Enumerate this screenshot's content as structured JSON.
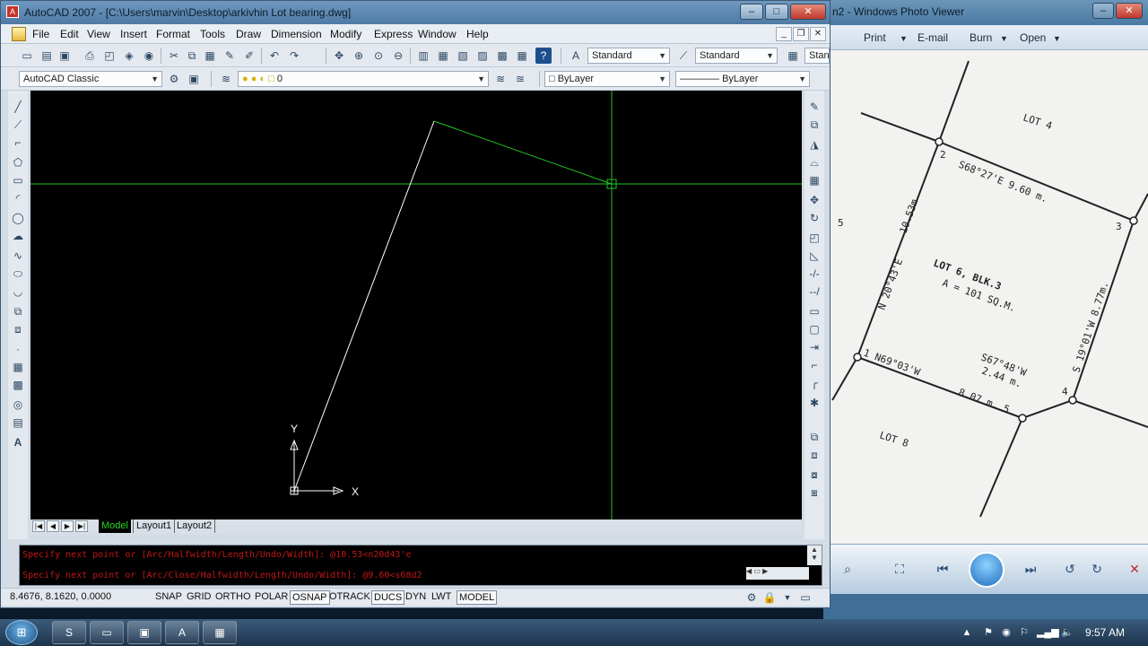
{
  "photo_viewer": {
    "title": "n2 - Windows Photo Viewer",
    "menu": [
      {
        "label": "Print"
      },
      {
        "label": "E-mail"
      },
      {
        "label": "Burn"
      },
      {
        "label": "Open"
      }
    ],
    "plan": {
      "lot4": "LOT 4",
      "lot8": "LOT 8",
      "title": "LOT 6, BLK.3",
      "area": "A = 101 SQ.M.",
      "b1": "S68°27'E   9.60 m.",
      "b2": "10.53m",
      "b3": "N 20°43'E",
      "b4": "S 19°01'W  8.77m.",
      "b5": "S67°48'W",
      "b6": "2.44 m.",
      "b7": "1 N69°03'W",
      "b8": "8.07 m. 5",
      "c2": "2",
      "c3": "3",
      "c4": "4",
      "edge": "5"
    }
  },
  "acad": {
    "title": "AutoCAD 2007 - [C:\\Users\\marvin\\Desktop\\arkivhin Lot bearing.dwg]",
    "menu": [
      "File",
      "Edit",
      "View",
      "Insert",
      "Format",
      "Tools",
      "Draw",
      "Dimension",
      "Modify",
      "Express",
      "Window",
      "Help"
    ],
    "toolbar1": {
      "text_style": "Standard",
      "dim_style": "Standard",
      "table_style": "Stan"
    },
    "toolbar2": {
      "workspace": "AutoCAD Classic",
      "layer": "0",
      "color": "ByLayer",
      "linetype": "ByLayer"
    },
    "ucs": {
      "x": "X",
      "y": "Y"
    },
    "layout_tabs": [
      "Model",
      "Layout1",
      "Layout2"
    ],
    "command": {
      "line1": "Specify next point or [Arc/Halfwidth/Length/Undo/Width]: @10.53<n20d43'e",
      "line2": "Specify next point or [Arc/Close/Halfwidth/Length/Undo/Width]: @9.60<s68d2"
    },
    "status": {
      "coords": "8.4676,  8.1620, 0.0000",
      "buttons": [
        "SNAP",
        "GRID",
        "ORTHO",
        "POLAR",
        "OSNAP",
        "OTRACK",
        "DUCS",
        "DYN",
        "LWT",
        "MODEL"
      ]
    }
  },
  "taskbar": {
    "clock": "9:57 AM"
  }
}
